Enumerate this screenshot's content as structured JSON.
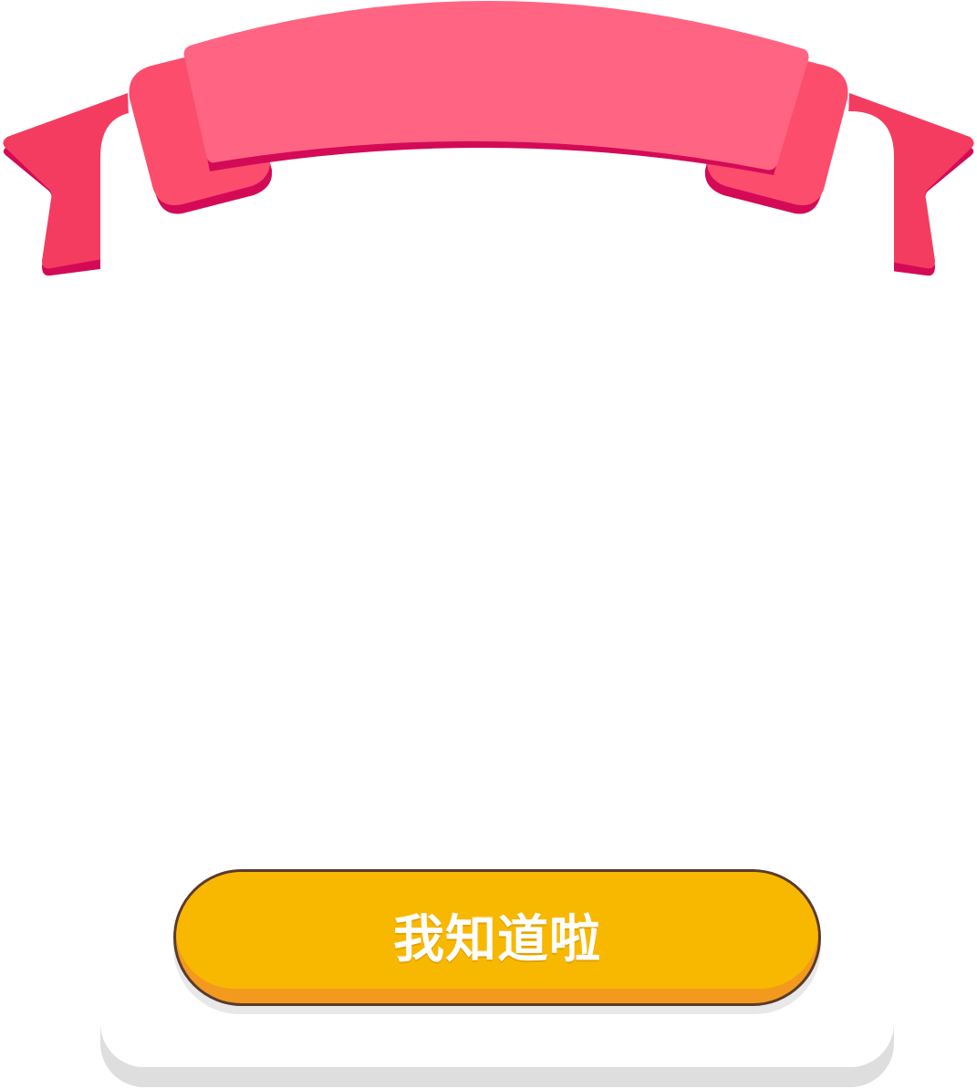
{
  "dialog": {
    "confirm_button_label": "我知道啦"
  },
  "colors": {
    "ribbon_main": "#ff6582",
    "ribbon_fold": "#fc4d6d",
    "ribbon_tail": "#f43c60",
    "ribbon_shadow": "#d40a57",
    "button_face": "#f9b800",
    "button_bottom": "#f39a1e",
    "button_border": "#5a3b2c",
    "card_background": "#ffffff"
  }
}
